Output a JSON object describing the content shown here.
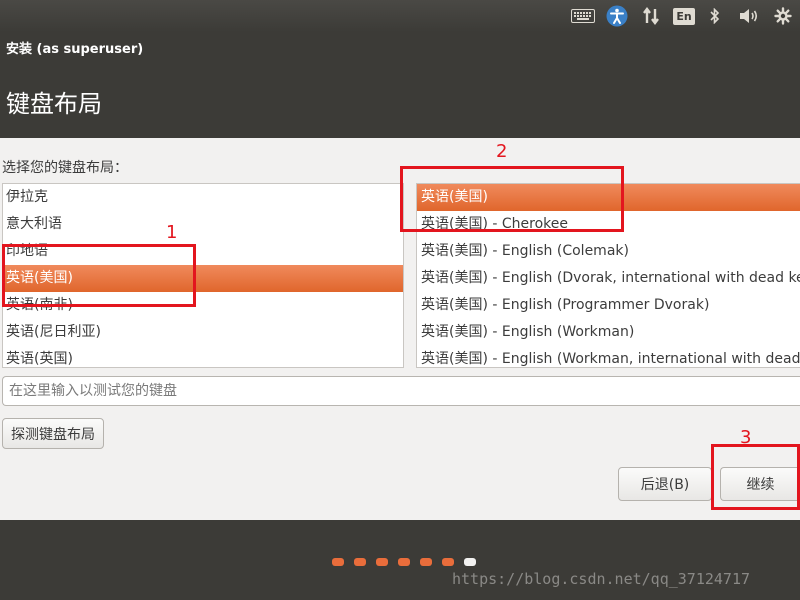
{
  "window": {
    "title": "安装 (as superuser)",
    "page_title": "键盘布局"
  },
  "panel": {
    "language_indicator": "En",
    "icons": [
      "keyboard-icon",
      "accessibility-icon",
      "network-icon",
      "keyboard-layout-indicator",
      "bluetooth-icon",
      "volume-icon",
      "settings-gear-icon"
    ]
  },
  "keyboard": {
    "choose_label": "选择您的键盘布局：",
    "languages": [
      "伊拉克",
      "意大利语",
      "印地语",
      "英语(美国)",
      "英语(南非)",
      "英语(尼日利亚)",
      "英语(英国)"
    ],
    "selected_language": "英语(美国)",
    "variants": [
      "英语(美国)",
      "英语(美国) - Cherokee",
      "英语(美国) - English (Colemak)",
      "英语(美国) - English (Dvorak, international with dead keys)",
      "英语(美国) - English (Programmer Dvorak)",
      "英语(美国) - English (Workman)",
      "英语(美国) - English (Workman, international with dead keys)"
    ],
    "selected_variant": "英语(美国)",
    "test_placeholder": "在这里输入以测试您的键盘",
    "detect_label": "探测键盘布局"
  },
  "buttons": {
    "back": "后退(B)",
    "continue": "继续"
  },
  "annotations": {
    "one": "1",
    "two": "2",
    "three": "3",
    "color": "#e3151e"
  },
  "progress": {
    "total_steps": 7,
    "current_step": 7
  },
  "watermark": "https://blog.csdn.net/qq_37124717",
  "colors": {
    "accent": "#e96d3b",
    "panel_bg": "#3c3b37",
    "content_bg": "#f2f1f0"
  }
}
